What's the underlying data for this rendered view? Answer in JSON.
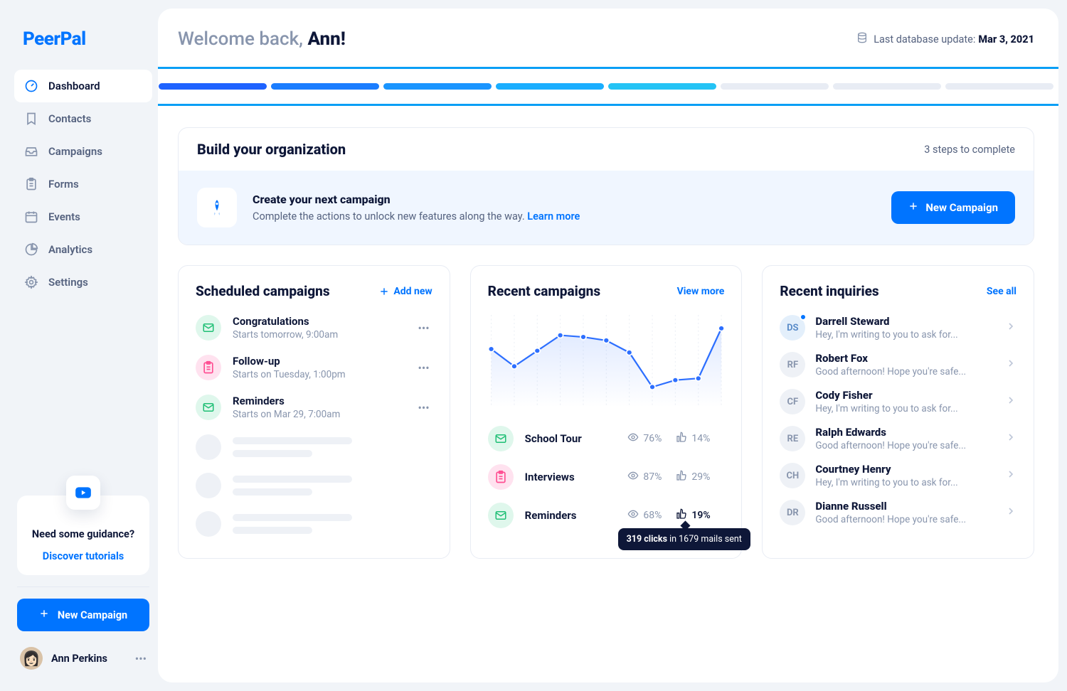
{
  "brand": "PeerPal",
  "nav": [
    {
      "label": "Dashboard",
      "icon": "gauge",
      "active": true
    },
    {
      "label": "Contacts",
      "icon": "bookmark",
      "active": false
    },
    {
      "label": "Campaigns",
      "icon": "inbox",
      "active": false
    },
    {
      "label": "Forms",
      "icon": "clipboard",
      "active": false
    },
    {
      "label": "Events",
      "icon": "calendar",
      "active": false
    },
    {
      "label": "Analytics",
      "icon": "pie",
      "active": false
    },
    {
      "label": "Settings",
      "icon": "gear",
      "active": false
    }
  ],
  "guidance": {
    "title": "Need some guidance?",
    "link": "Discover tutorials"
  },
  "sidebar_new_campaign": "New Campaign",
  "profile": {
    "name": "Ann Perkins"
  },
  "welcome": {
    "prefix": "Welcome back, ",
    "name": "Ann!"
  },
  "db_update": {
    "label": "Last database update: ",
    "date": "Mar 3, 2021"
  },
  "progress": {
    "segments": [
      {
        "color": "#1f63ff"
      },
      {
        "color": "#1b7dff"
      },
      {
        "color": "#1a95ff"
      },
      {
        "color": "#1aaeff"
      },
      {
        "color": "#24c3f5"
      },
      {
        "color": "#e8ecf4"
      },
      {
        "color": "#e8ecf4"
      },
      {
        "color": "#e8ecf4"
      }
    ]
  },
  "build": {
    "title": "Build your organization",
    "steps": "3 steps to complete",
    "banner_title": "Create your next campaign",
    "banner_text": "Complete the actions to unlock new features along the way. ",
    "learn_more": "Learn more",
    "button": "New Campaign"
  },
  "scheduled": {
    "title": "Scheduled campaigns",
    "add": "Add new",
    "items": [
      {
        "title": "Congratulations",
        "sub": "Starts tomorrow, 9:00am",
        "color": "green",
        "icon": "mail"
      },
      {
        "title": "Follow-up",
        "sub": "Starts on Tuesday, 1:00pm",
        "color": "pink",
        "icon": "clipboard"
      },
      {
        "title": "Reminders",
        "sub": "Starts on Mar 29, 7:00am",
        "color": "green",
        "icon": "mail"
      }
    ]
  },
  "recent": {
    "title": "Recent campaigns",
    "link": "View more",
    "items": [
      {
        "name": "School Tour",
        "views": "76%",
        "clicks": "14%",
        "color": "green",
        "icon": "mail",
        "highlight": false
      },
      {
        "name": "Interviews",
        "views": "87%",
        "clicks": "29%",
        "color": "pink",
        "icon": "clipboard",
        "highlight": false
      },
      {
        "name": "Reminders",
        "views": "68%",
        "clicks": "19%",
        "color": "green",
        "icon": "mail",
        "highlight": true
      }
    ],
    "tooltip": {
      "bold": "319 clicks",
      "rest": " in 1679 mails sent"
    }
  },
  "inquiries": {
    "title": "Recent inquiries",
    "link": "See all",
    "items": [
      {
        "initials": "DS",
        "name": "Darrell Steward",
        "msg": "Hey, I'm writing to you to ask for...",
        "blue": true,
        "dot": true
      },
      {
        "initials": "RF",
        "name": "Robert Fox",
        "msg": "Good afternoon! Hope you're safe...",
        "blue": false,
        "dot": false
      },
      {
        "initials": "CF",
        "name": "Cody Fisher",
        "msg": "Hey, I'm writing to you to ask for...",
        "blue": false,
        "dot": false
      },
      {
        "initials": "RE",
        "name": "Ralph Edwards",
        "msg": "Good afternoon! Hope you're safe...",
        "blue": false,
        "dot": false
      },
      {
        "initials": "CH",
        "name": "Courtney Henry",
        "msg": "Hey, I'm writing to you to ask for...",
        "blue": false,
        "dot": false
      },
      {
        "initials": "DR",
        "name": "Dianne Russell",
        "msg": "Good afternoon! Hope you're safe...",
        "blue": false,
        "dot": false
      }
    ]
  },
  "chart_data": {
    "type": "line",
    "x": [
      0,
      1,
      2,
      3,
      4,
      5,
      6,
      7,
      8,
      9
    ],
    "values": [
      64,
      44,
      62,
      80,
      78,
      74,
      60,
      20,
      28,
      30,
      88
    ],
    "ylim": [
      0,
      100
    ]
  }
}
